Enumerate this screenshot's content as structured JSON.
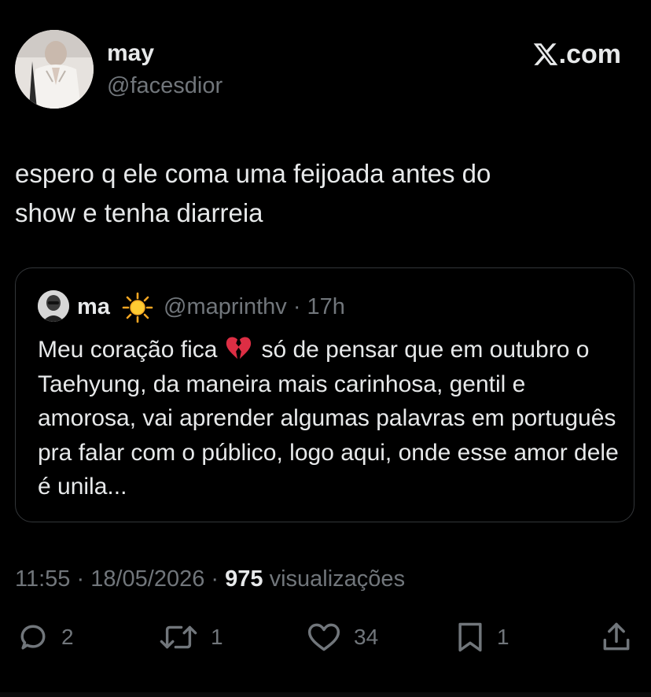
{
  "author": {
    "display_name": "may",
    "handle": "@facesdior"
  },
  "brand": {
    "label": ".com",
    "icon": "x-logo-icon"
  },
  "tweet": {
    "text": "espero q ele coma uma feijoada antes do\nshow e tenha diarreia"
  },
  "quote": {
    "display_name": "ma",
    "emoji": "sun-emoji-icon",
    "handle_time": "@maprinthv · 17h",
    "text_before_emoji": "Meu coração fica",
    "emoji_inline": "broken-heart-emoji-icon",
    "text_after_emoji": "só de pensar que em outubro o Taehyung, da maneira mais carinhosa, gentil e amorosa, vai aprender algumas palavras em português pra falar com o público, logo aqui, onde esse amor dele é unila..."
  },
  "meta": {
    "time": "11:55",
    "separator": " · ",
    "date": "18/05/2026",
    "views_count": "975",
    "views_label": "visualizações"
  },
  "actions": {
    "replies": "2",
    "reposts": "1",
    "likes": "34",
    "bookmarks": "1"
  }
}
